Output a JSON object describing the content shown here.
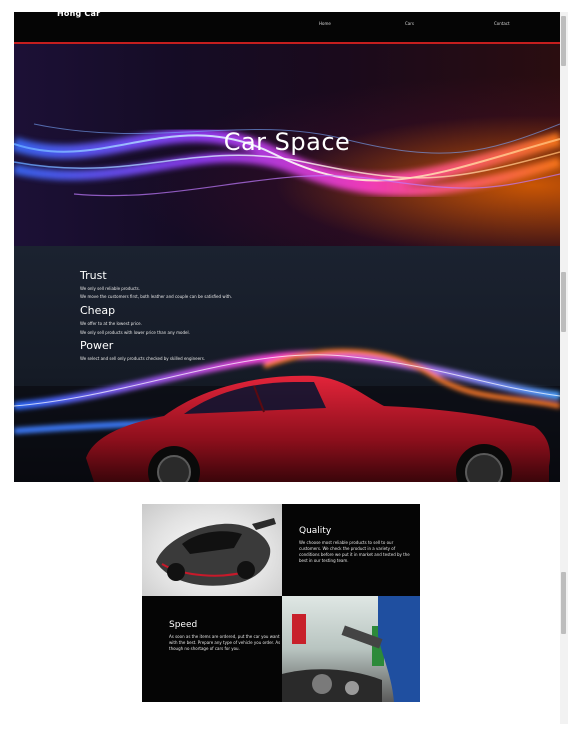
{
  "nav": {
    "brand": "Hong Car",
    "links": [
      "Home",
      "Cars",
      "Contact"
    ]
  },
  "hero": {
    "title": "Car Space"
  },
  "features": [
    {
      "heading": "Trust",
      "lines": [
        "We only sell reliable products.",
        "We move the customers first, both leather and couple can be satisfied with."
      ]
    },
    {
      "heading": "Cheap",
      "lines": [
        "We offer to at the lowest price.",
        "We only sell products with lower price than any model."
      ]
    },
    {
      "heading": "Power",
      "lines": [
        "We select and sell only products checked by skilled engineers."
      ]
    }
  ],
  "grid": {
    "quality": {
      "heading": "Quality",
      "text": "We choose most reliable products to sell to our customers. We check the product in a variety of conditions before we put it in market and tested by the best in our testing team."
    },
    "speed": {
      "heading": "Speed",
      "text": "As soon as the items are ordered, put the car you want with the best. Prepare any type of vehicle you order. As though no shortage of cars for you."
    }
  },
  "colors": {
    "nav_bg": "#050505",
    "accent": "#c41e1e"
  }
}
